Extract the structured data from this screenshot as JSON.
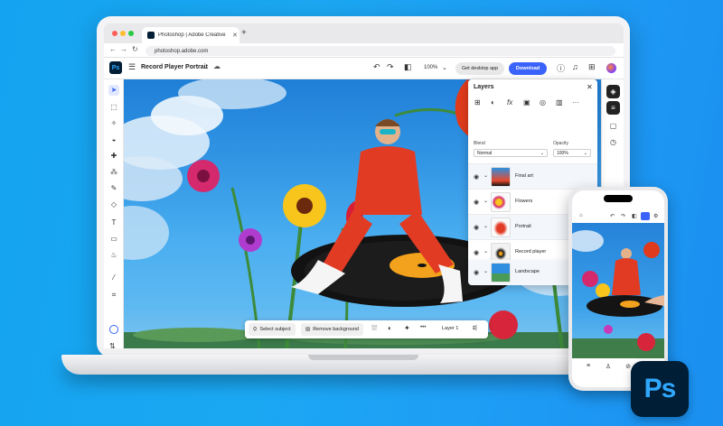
{
  "browser": {
    "tab_title": "Photoshop | Adobe Creative",
    "tab_close": "✕",
    "new_tab": "+",
    "url": "photoshop.adobe.com"
  },
  "appbar": {
    "logo": "Ps",
    "document_title": "Record Player Portrait",
    "zoom": "100%",
    "get_desktop_app": "Get desktop app",
    "download": "Download"
  },
  "layers_panel": {
    "title": "Layers",
    "blend_label": "Blend",
    "blend_value": "Normal",
    "opacity_label": "Opacity",
    "opacity_value": "100%",
    "layers": [
      {
        "name": "Final art"
      },
      {
        "name": "Flowers"
      },
      {
        "name": "Portrait"
      },
      {
        "name": "Record player"
      },
      {
        "name": "Landscape"
      }
    ]
  },
  "context_bar": {
    "select_subject": "Select subject",
    "remove_background": "Remove background",
    "more": "•••",
    "layer": "Layer 1"
  },
  "brand": {
    "ps_icon": "Ps",
    "accent": "#3b63fb",
    "ps_dark": "#001e36",
    "ps_blue": "#31a8ff"
  }
}
